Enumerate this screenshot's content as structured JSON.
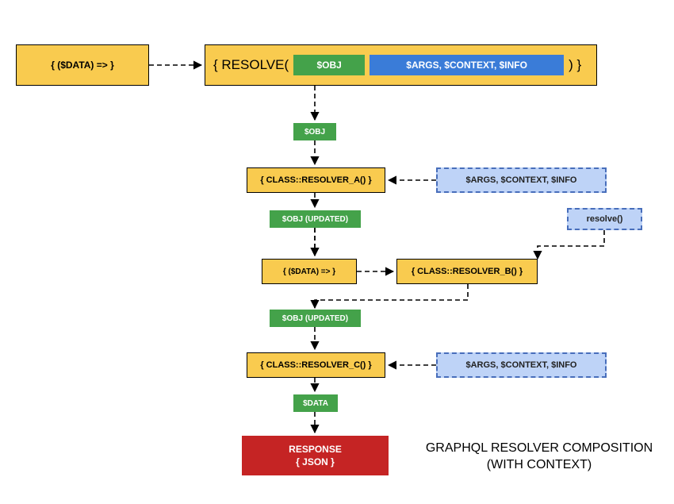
{
  "top": {
    "data_fn": "{  ($DATA)   =>  }",
    "resolve_open": "{  RESOLVE(",
    "resolve_close": ")  }",
    "obj_pill": "$OBJ",
    "args_pill": "$ARGS, $CONTEXT, $INFO"
  },
  "tags": {
    "obj": "$OBJ",
    "obj_updated_1": "$OBJ (UPDATED)",
    "obj_updated_2": "$OBJ (UPDATED)",
    "data": "$DATA"
  },
  "resolvers": {
    "a": "{  CLASS::RESOLVER_A()  }",
    "b": "{  CLASS::RESOLVER_B()  }",
    "c": "{  CLASS::RESOLVER_C()  }",
    "data_fn_mid": "{  ($DATA)   =>  }"
  },
  "context": {
    "a": "$ARGS,  $CONTEXT,  $INFO",
    "b": "resolve()",
    "c": "$ARGS,  $CONTEXT,  $INFO"
  },
  "response": {
    "line1": "RESPONSE",
    "line2": "{ JSON }"
  },
  "title": {
    "line1": "GRAPHQL RESOLVER COMPOSITION",
    "line2": "(WITH CONTEXT)"
  },
  "chart_data": {
    "type": "flowchart",
    "title": "GRAPHQL RESOLVER COMPOSITION (WITH CONTEXT)",
    "nodes": [
      {
        "id": "data_fn_top",
        "label": "{ ($DATA) => }",
        "kind": "box",
        "color": "yellow"
      },
      {
        "id": "resolve",
        "label": "{ RESOLVE( $OBJ $ARGS, $CONTEXT, $INFO ) }",
        "kind": "box",
        "color": "yellow"
      },
      {
        "id": "obj_tag",
        "label": "$OBJ",
        "kind": "tag",
        "color": "green"
      },
      {
        "id": "resolver_a",
        "label": "{ CLASS::RESOLVER_A() }",
        "kind": "box",
        "color": "yellow"
      },
      {
        "id": "ctx_a",
        "label": "$ARGS, $CONTEXT, $INFO",
        "kind": "box",
        "color": "lightblue"
      },
      {
        "id": "obj_upd_1",
        "label": "$OBJ (UPDATED)",
        "kind": "tag",
        "color": "green"
      },
      {
        "id": "data_fn_mid",
        "label": "{ ($DATA) => }",
        "kind": "box",
        "color": "yellow"
      },
      {
        "id": "resolver_b",
        "label": "{ CLASS::RESOLVER_B() }",
        "kind": "box",
        "color": "yellow"
      },
      {
        "id": "ctx_b",
        "label": "resolve()",
        "kind": "box",
        "color": "lightblue"
      },
      {
        "id": "obj_upd_2",
        "label": "$OBJ (UPDATED)",
        "kind": "tag",
        "color": "green"
      },
      {
        "id": "resolver_c",
        "label": "{ CLASS::RESOLVER_C() }",
        "kind": "box",
        "color": "yellow"
      },
      {
        "id": "ctx_c",
        "label": "$ARGS, $CONTEXT, $INFO",
        "kind": "box",
        "color": "lightblue"
      },
      {
        "id": "data_tag",
        "label": "$DATA",
        "kind": "tag",
        "color": "green"
      },
      {
        "id": "response",
        "label": "RESPONSE { JSON }",
        "kind": "box",
        "color": "red"
      }
    ],
    "edges": [
      {
        "from": "data_fn_top",
        "to": "resolve",
        "style": "dashed"
      },
      {
        "from": "resolve",
        "to": "obj_tag",
        "style": "dashed"
      },
      {
        "from": "obj_tag",
        "to": "resolver_a",
        "style": "dashed"
      },
      {
        "from": "ctx_a",
        "to": "resolver_a",
        "style": "dashed"
      },
      {
        "from": "resolver_a",
        "to": "obj_upd_1",
        "style": "dashed"
      },
      {
        "from": "obj_upd_1",
        "to": "data_fn_mid",
        "style": "dashed",
        "path": "down-right"
      },
      {
        "from": "data_fn_mid",
        "to": "resolver_b",
        "style": "dashed"
      },
      {
        "from": "ctx_b",
        "to": "resolver_b",
        "style": "dashed",
        "path": "down-left"
      },
      {
        "from": "resolver_b",
        "to": "obj_upd_2",
        "style": "dashed",
        "path": "down-left"
      },
      {
        "from": "obj_upd_2",
        "to": "resolver_c",
        "style": "dashed"
      },
      {
        "from": "ctx_c",
        "to": "resolver_c",
        "style": "dashed"
      },
      {
        "from": "resolver_c",
        "to": "data_tag",
        "style": "dashed"
      },
      {
        "from": "data_tag",
        "to": "response",
        "style": "dashed"
      }
    ]
  }
}
